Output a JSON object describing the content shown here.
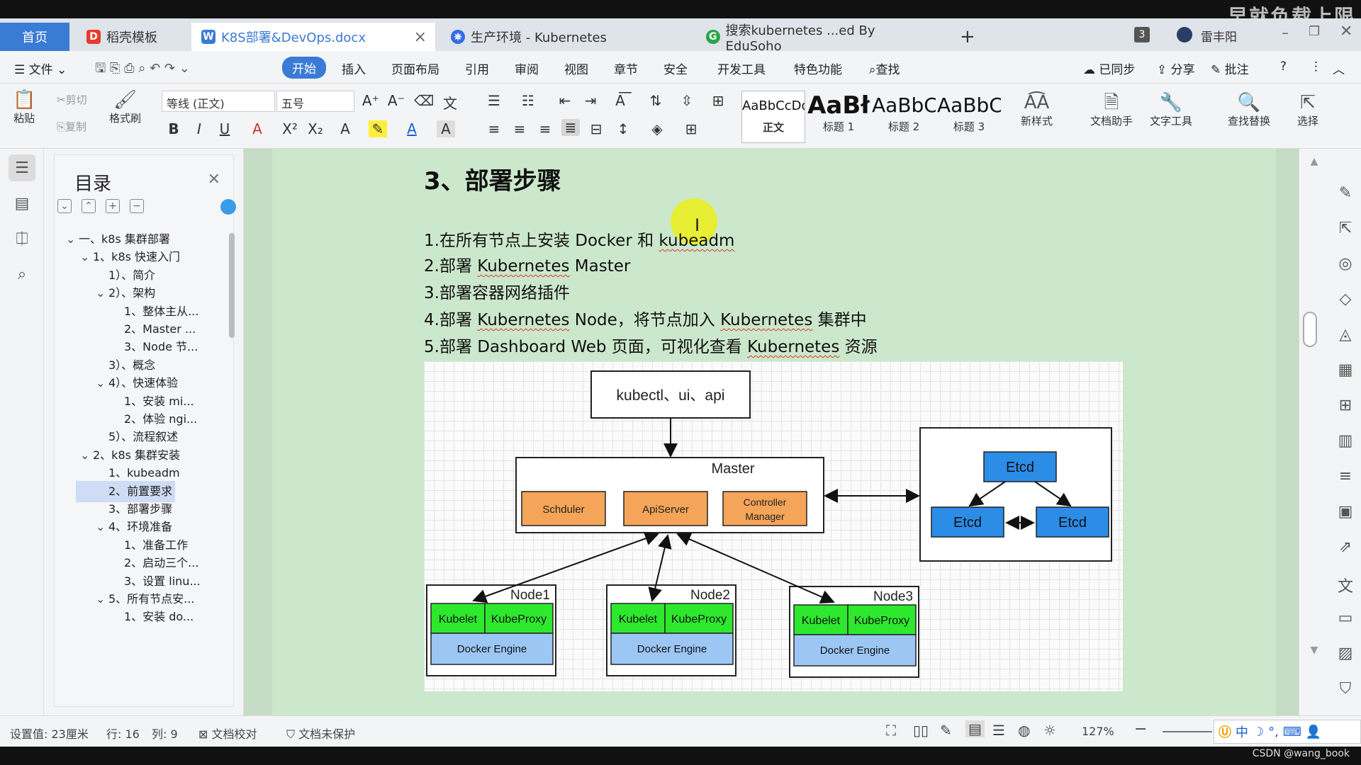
{
  "watermark": "早就负载上限",
  "tabs": [
    {
      "label": "首页"
    },
    {
      "label": "稻壳模板"
    },
    {
      "label": "K8S部署&DevOps.docx"
    },
    {
      "label": "生产环境 - Kubernetes"
    },
    {
      "label": "搜索kubernetes ...ed By EduSoho"
    }
  ],
  "tab_count": "3",
  "user_name": "雷丰阳",
  "menu": {
    "file": "文件",
    "items": [
      "开始",
      "插入",
      "页面布局",
      "引用",
      "审阅",
      "视图",
      "章节",
      "安全",
      "开发工具",
      "特色功能"
    ],
    "search": "查找",
    "synced": "已同步",
    "share": "分享",
    "comment": "批注"
  },
  "ribbon": {
    "paste": "粘贴",
    "cut": "剪切",
    "copy": "复制",
    "format_painter": "格式刷",
    "font_name": "等线 (正文)",
    "font_size": "五号",
    "styles": [
      {
        "preview": "AaBbCcDd",
        "label": "正文"
      },
      {
        "preview": "AaBł",
        "label": "标题 1"
      },
      {
        "preview": "AaBbC",
        "label": "标题 2"
      },
      {
        "preview": "AaBbC",
        "label": "标题 3"
      }
    ],
    "new_style": "新样式",
    "doc_assistant": "文档助手",
    "text_tools": "文字工具",
    "find_replace": "查找替换",
    "select": "选择"
  },
  "toc": {
    "title": "目录",
    "items": [
      {
        "text": "一、k8s 集群部署",
        "level": 0,
        "caret": "v"
      },
      {
        "text": "1、k8s 快速入门",
        "level": 1,
        "caret": "v"
      },
      {
        "text": "1）、简介",
        "level": 2,
        "caret": ""
      },
      {
        "text": "2）、架构",
        "level": 2,
        "caret": "v"
      },
      {
        "text": "1、整体主从...",
        "level": 3,
        "caret": ""
      },
      {
        "text": "2、Master ...",
        "level": 3,
        "caret": ""
      },
      {
        "text": "3、Node 节...",
        "level": 3,
        "caret": ""
      },
      {
        "text": "3）、概念",
        "level": 2,
        "caret": ""
      },
      {
        "text": "4）、快速体验",
        "level": 2,
        "caret": "v"
      },
      {
        "text": "1、安装 mi...",
        "level": 3,
        "caret": ""
      },
      {
        "text": "2、体验 ngi...",
        "level": 3,
        "caret": ""
      },
      {
        "text": "5）、流程叙述",
        "level": 2,
        "caret": ""
      },
      {
        "text": "2、k8s 集群安装",
        "level": 1,
        "caret": "v"
      },
      {
        "text": "1、kubeadm",
        "level": 2,
        "caret": ""
      },
      {
        "text": "2、前置要求",
        "level": 2,
        "caret": "",
        "active": true
      },
      {
        "text": "3、部署步骤",
        "level": 2,
        "caret": ""
      },
      {
        "text": "4、环境准备",
        "level": 2,
        "caret": "v"
      },
      {
        "text": "1、准备工作",
        "level": 3,
        "caret": ""
      },
      {
        "text": "2、启动三个...",
        "level": 3,
        "caret": ""
      },
      {
        "text": "3、设置 linu...",
        "level": 3,
        "caret": ""
      },
      {
        "text": "5、所有节点安...",
        "level": 2,
        "caret": "v"
      },
      {
        "text": "1、安装 do...",
        "level": 3,
        "caret": ""
      }
    ]
  },
  "doc": {
    "heading": "3、部署步骤",
    "steps": [
      "1.在所有节点上安装 Docker 和 kubeadm",
      "2.部署 Kubernetes Master",
      "3.部署容器网络插件",
      "4.部署  Kubernetes Node，将节点加入 Kubernetes 集群中",
      "5.部署 Dashboard Web 页面，可视化查看 Kubernetes 资源"
    ]
  },
  "diagram": {
    "client": "kubectl、ui、api",
    "master": "Master",
    "scheduler": "Schduler",
    "apiserver": "ApiServer",
    "controller": [
      "Controller",
      "Manager"
    ],
    "etcd": "Etcd",
    "nodes": [
      {
        "name": "Node1",
        "kubelet": "Kubelet",
        "proxy": "KubeProxy",
        "engine": "Docker Engine"
      },
      {
        "name": "Node2",
        "kubelet": "Kubelet",
        "proxy": "KubeProxy",
        "engine": "Docker Engine"
      },
      {
        "name": "Node3",
        "kubelet": "Kubelet",
        "proxy": "KubeProxy",
        "engine": "Docker Engine"
      }
    ],
    "colors": {
      "orange": "#f5a55a",
      "blue": "#2b8de6",
      "green": "#2ee82e",
      "lightblue": "#9cc7f5"
    }
  },
  "status": {
    "setting": "设置值: 23厘米",
    "row": "行: 16",
    "col": "列: 9",
    "proof": "文档校对",
    "protect": "文档未保护",
    "zoom": "127%"
  },
  "ime": {
    "lang": "中"
  },
  "footer": "CSDN @wang_book"
}
